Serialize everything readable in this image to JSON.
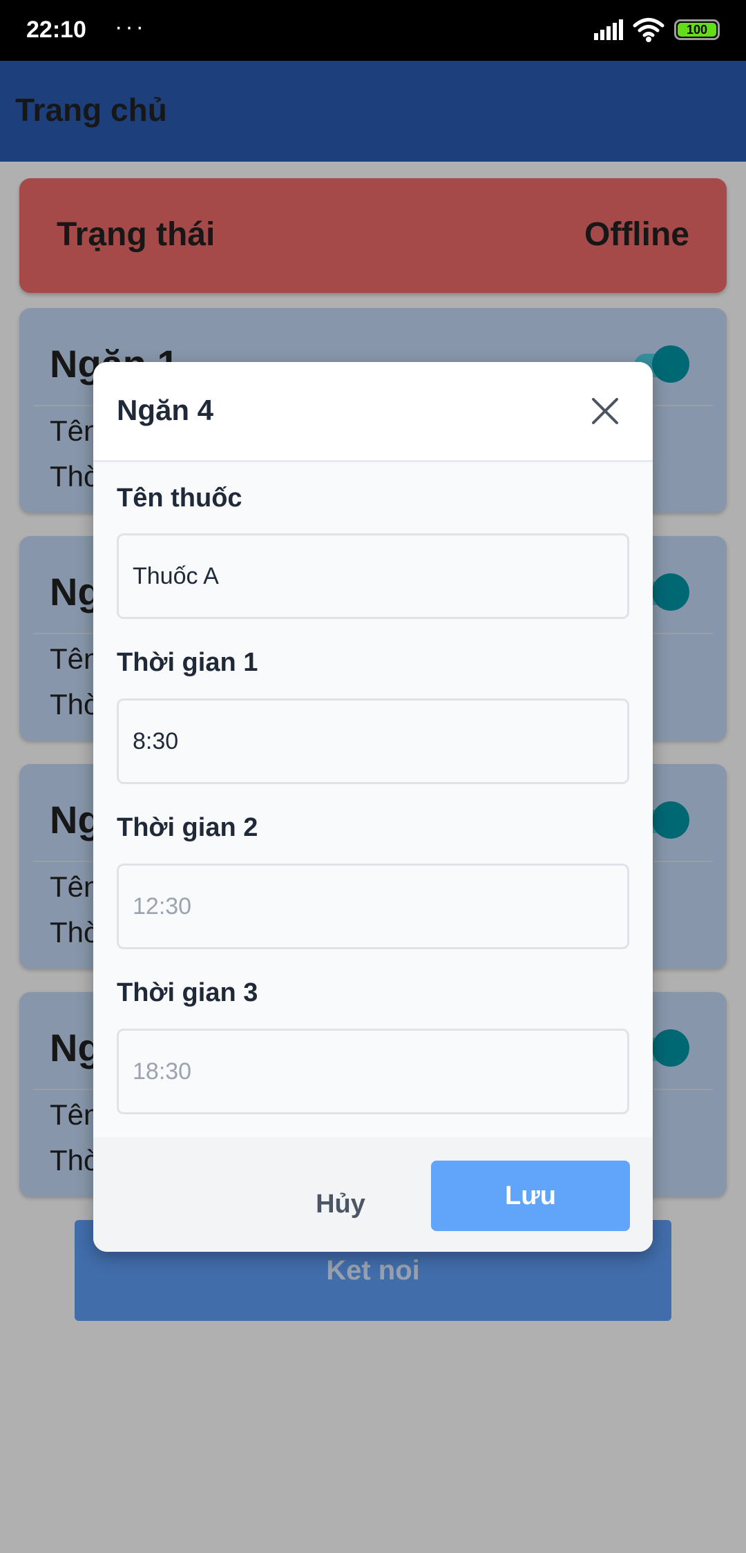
{
  "status_bar": {
    "time": "22:10",
    "dots": "···",
    "battery": "100"
  },
  "app_bar": {
    "title": "Trang chủ"
  },
  "status_card": {
    "label": "Trạng thái",
    "value": "Offline",
    "color": "#ef6b6b"
  },
  "slots": [
    {
      "title": "Ngăn 1",
      "name_line": "Tên",
      "time_line": "Thờ"
    },
    {
      "title": "Ng",
      "name_line": "Tên",
      "time_line": "Thờ"
    },
    {
      "title": "Ng",
      "name_line": "Tên",
      "time_line": "Thờ"
    },
    {
      "title": "Ng",
      "name_line": "Tên",
      "time_line": "Thờ"
    }
  ],
  "connect_button": {
    "label": "Ket noi"
  },
  "modal": {
    "title": "Ngăn 4",
    "fields": [
      {
        "label": "Tên thuốc",
        "value": "Thuốc A",
        "placeholder": ""
      },
      {
        "label": "Thời gian 1",
        "value": "8:30",
        "placeholder": ""
      },
      {
        "label": "Thời gian 2",
        "value": "",
        "placeholder": "12:30"
      },
      {
        "label": "Thời gian 3",
        "value": "",
        "placeholder": "18:30"
      }
    ],
    "cancel_label": "Hủy",
    "save_label": "Lưu"
  },
  "colors": {
    "app_bar": "#2b5cb3",
    "slot_card": "#c4daf7",
    "toggle_on": "#0097a7",
    "save_button": "#60a5fa"
  },
  "icons": [
    "more-dots-icon",
    "signal-icon",
    "wifi-icon",
    "battery-icon",
    "close-icon"
  ]
}
